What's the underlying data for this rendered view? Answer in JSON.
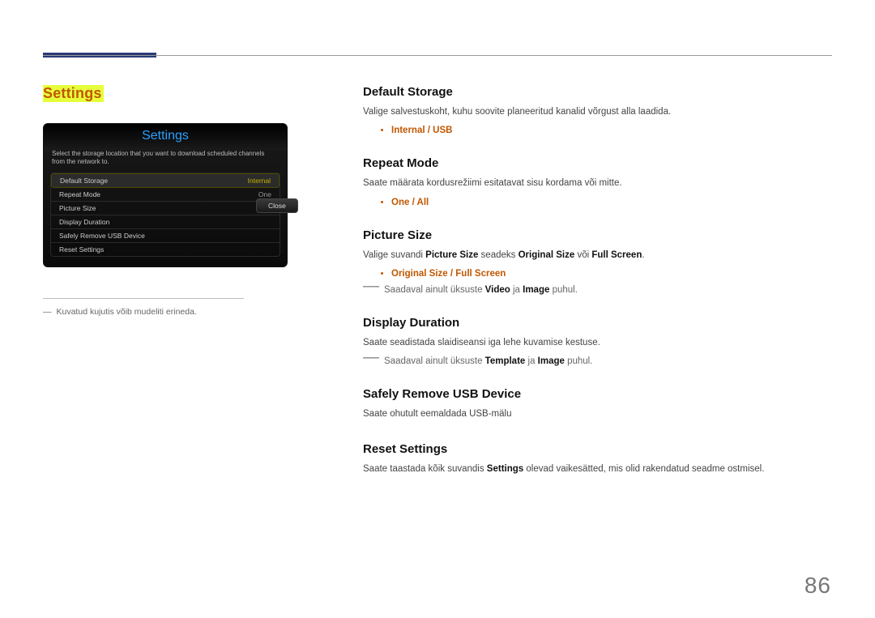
{
  "page_number": "86",
  "left": {
    "section_label": "Settings",
    "panel": {
      "title": "Settings",
      "hint": "Select the storage location that you want to download scheduled channels from the network to.",
      "rows": [
        {
          "key": "Default Storage",
          "val": "Internal",
          "selected": true
        },
        {
          "key": "Repeat Mode",
          "val": "One"
        },
        {
          "key": "Picture Size",
          "val": ""
        },
        {
          "key": "Display Duration",
          "val": ""
        },
        {
          "key": "Safely Remove USB Device",
          "val": ""
        },
        {
          "key": "Reset Settings",
          "val": ""
        }
      ],
      "close_label": "Close"
    },
    "footnote_dash": "―",
    "footnote": "Kuvatud kujutis võib mudeliti erineda."
  },
  "right": {
    "default_storage": {
      "title": "Default Storage",
      "desc": "Valige salvestuskoht, kuhu soovite planeeritud kanalid võrgust alla laadida.",
      "opt1": "Internal",
      "sep": " / ",
      "opt2": "USB"
    },
    "repeat_mode": {
      "title": "Repeat Mode",
      "desc": "Saate määrata kordusrežiimi esitatavat sisu kordama või mitte.",
      "opt1": "One",
      "sep": " / ",
      "opt2": "All"
    },
    "picture_size": {
      "title": "Picture Size",
      "desc_pre": "Valige suvandi ",
      "desc_b1": "Picture Size",
      "desc_mid": " seadeks ",
      "desc_b2": "Original Size",
      "desc_or": " või ",
      "desc_b3": "Full Screen",
      "desc_end": ".",
      "opt1": "Original Size",
      "sep": " / ",
      "opt2": "Full Screen",
      "note_pre": "Saadaval ainult üksuste ",
      "note_b1": "Video",
      "note_and": " ja ",
      "note_b2": "Image",
      "note_end": " puhul."
    },
    "display_duration": {
      "title": "Display Duration",
      "desc": "Saate seadistada slaidiseansi iga lehe kuvamise kestuse.",
      "note_pre": "Saadaval ainult üksuste ",
      "note_b1": "Template",
      "note_and": " ja ",
      "note_b2": "Image",
      "note_end": " puhul."
    },
    "safely_remove": {
      "title": "Safely Remove USB Device",
      "desc": "Saate ohutult eemaldada USB-mälu"
    },
    "reset": {
      "title": "Reset Settings",
      "desc_pre": "Saate taastada kõik suvandis ",
      "desc_b1": "Settings",
      "desc_end": " olevad vaikesätted, mis olid rakendatud seadme ostmisel."
    }
  }
}
